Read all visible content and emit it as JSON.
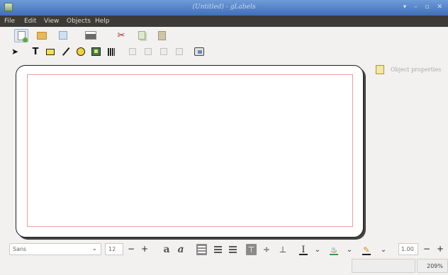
{
  "window": {
    "title": "(Untitled) - gLabels",
    "controls": "▾ – ▫ ✕"
  },
  "menu": [
    "File",
    "Edit",
    "View",
    "Objects",
    "Help"
  ],
  "toolbar_main": [
    {
      "name": "new-icon",
      "active": true
    },
    {
      "name": "open-icon"
    },
    {
      "name": "save-icon"
    },
    {
      "name": "print-icon"
    },
    {
      "name": "cut-icon"
    },
    {
      "name": "copy-icon"
    },
    {
      "name": "paste-icon"
    }
  ],
  "toolbar_objects": [
    {
      "name": "select-arrow-icon",
      "glyph": "➤"
    },
    {
      "name": "text-tool-icon",
      "glyph": "T"
    },
    {
      "name": "rectangle-tool-icon"
    },
    {
      "name": "line-tool-icon"
    },
    {
      "name": "ellipse-tool-icon"
    },
    {
      "name": "image-tool-icon"
    },
    {
      "name": "barcode-tool-icon"
    },
    {
      "name": "zoom-in-icon"
    },
    {
      "name": "zoom-out-icon"
    },
    {
      "name": "zoom-1to1-icon"
    },
    {
      "name": "zoom-fit-icon"
    },
    {
      "name": "merge-properties-icon"
    }
  ],
  "right_panel": {
    "object_properties_label": "Object properties"
  },
  "format_bar": {
    "font_family": "Sans",
    "font_size": "12",
    "line_width": "1.00",
    "text_color": "#222222",
    "fill_color": "#3a9c3a",
    "line_color": "#222222",
    "minus": "−",
    "plus": "+",
    "chevron": "⌄"
  },
  "status": {
    "zoom": "209%"
  }
}
